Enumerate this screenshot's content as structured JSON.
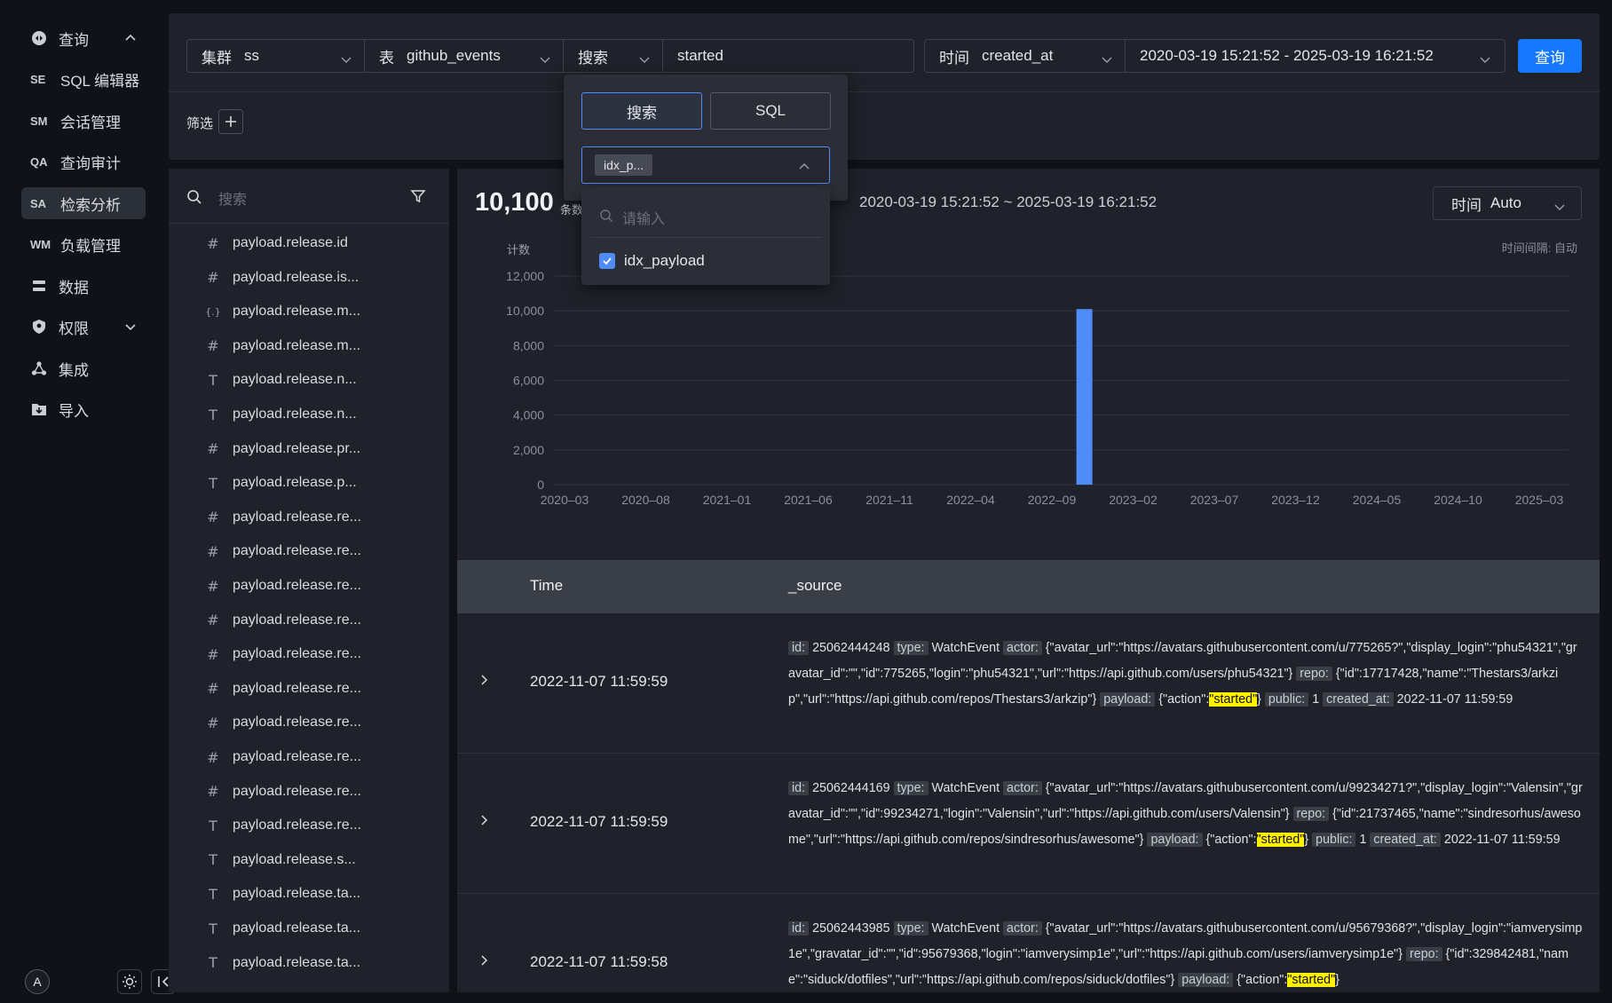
{
  "nav": {
    "query": "查询",
    "items": [
      {
        "abbr": "SE",
        "label": "SQL 编辑器"
      },
      {
        "abbr": "SM",
        "label": "会话管理"
      },
      {
        "abbr": "QA",
        "label": "查询审计"
      },
      {
        "abbr": "SA",
        "label": "检索分析"
      },
      {
        "abbr": "WM",
        "label": "负载管理"
      }
    ],
    "data": "数据",
    "permission": "权限",
    "integration": "集成",
    "import": "导入",
    "avatar": "A"
  },
  "querybar": {
    "cluster_label": "集群",
    "cluster_value": "ss",
    "table_label": "表",
    "table_value": "github_events",
    "mode_label": "搜索",
    "search_text": "started",
    "time_label": "时间",
    "time_field": "created_at",
    "time_range": "2020-03-19 15:21:52 - 2025-03-19 16:21:52",
    "query_button": "查询"
  },
  "filter": {
    "label": "筛选"
  },
  "popover": {
    "search_tab": "搜索",
    "sql_tab": "SQL",
    "selected_tag": "idx_p...",
    "input_placeholder": "请输入",
    "option": "idx_payload"
  },
  "fieldlist": {
    "search_placeholder": "搜索",
    "fields": [
      {
        "type": "#",
        "name": "payload.release.id"
      },
      {
        "type": "#",
        "name": "payload.release.is..."
      },
      {
        "type": "{.}",
        "name": "payload.release.m..."
      },
      {
        "type": "#",
        "name": "payload.release.m..."
      },
      {
        "type": "T",
        "name": "payload.release.n..."
      },
      {
        "type": "T",
        "name": "payload.release.n..."
      },
      {
        "type": "#",
        "name": "payload.release.pr..."
      },
      {
        "type": "T",
        "name": "payload.release.p..."
      },
      {
        "type": "#",
        "name": "payload.release.re..."
      },
      {
        "type": "#",
        "name": "payload.release.re..."
      },
      {
        "type": "#",
        "name": "payload.release.re..."
      },
      {
        "type": "#",
        "name": "payload.release.re..."
      },
      {
        "type": "#",
        "name": "payload.release.re..."
      },
      {
        "type": "#",
        "name": "payload.release.re..."
      },
      {
        "type": "#",
        "name": "payload.release.re..."
      },
      {
        "type": "#",
        "name": "payload.release.re..."
      },
      {
        "type": "#",
        "name": "payload.release.re..."
      },
      {
        "type": "T",
        "name": "payload.release.re..."
      },
      {
        "type": "T",
        "name": "payload.release.s..."
      },
      {
        "type": "T",
        "name": "payload.release.ta..."
      },
      {
        "type": "T",
        "name": "payload.release.ta..."
      },
      {
        "type": "T",
        "name": "payload.release.ta..."
      }
    ]
  },
  "results": {
    "count": "10,100",
    "count_unit": "条数",
    "range": "2020-03-19 15:21:52 ~ 2025-03-19 16:21:52",
    "interval_label": "时间",
    "interval_value": "Auto"
  },
  "chart_data": {
    "type": "bar",
    "ylabel": "计数",
    "note": "时间间隔: 自动",
    "ylim": [
      0,
      12000
    ],
    "yticks": [
      0,
      2000,
      4000,
      6000,
      8000,
      10000,
      12000
    ],
    "ytick_labels": [
      "0",
      "2,000",
      "4,000",
      "6,000",
      "8,000",
      "10,000",
      "12,000"
    ],
    "xticks": [
      "2020–03",
      "2020–08",
      "2021–01",
      "2021–06",
      "2021–11",
      "2022–04",
      "2022–09",
      "2023–02",
      "2023–07",
      "2023–12",
      "2024–05",
      "2024–10",
      "2025–03"
    ],
    "bars": [
      {
        "x": "2022-11",
        "value": 10100
      }
    ],
    "color": "#4f8cf7"
  },
  "table": {
    "col_time": "Time",
    "col_source": "_source",
    "rows": [
      {
        "time": "2022-11-07 11:59:59",
        "source": [
          {
            "k": "id:"
          },
          {
            "t": " 25062444248 "
          },
          {
            "k": "type:"
          },
          {
            "t": " WatchEvent "
          },
          {
            "k": "actor:"
          },
          {
            "t": " {\"avatar_url\":\"https://avatars.githubusercontent.com/u/775265?\",\"display_login\":\"phu54321\",\"gravatar_id\":\"\",\"id\":775265,\"login\":\"phu54321\",\"url\":\"https://api.github.com/users/phu54321\"} "
          },
          {
            "k": "repo:"
          },
          {
            "t": " {\"id\":17717428,\"name\":\"Thestars3/arkzip\",\"url\":\"https://api.github.com/repos/Thestars3/arkzip\"} "
          },
          {
            "k": "payload:"
          },
          {
            "t": " {\"action\":"
          },
          {
            "h": "\"started\""
          },
          {
            "t": "} "
          },
          {
            "k": "public:"
          },
          {
            "t": " 1 "
          },
          {
            "k": "created_at:"
          },
          {
            "t": " 2022-11-07 11:59:59"
          }
        ]
      },
      {
        "time": "2022-11-07 11:59:59",
        "source": [
          {
            "k": "id:"
          },
          {
            "t": " 25062444169 "
          },
          {
            "k": "type:"
          },
          {
            "t": " WatchEvent "
          },
          {
            "k": "actor:"
          },
          {
            "t": " {\"avatar_url\":\"https://avatars.githubusercontent.com/u/99234271?\",\"display_login\":\"Valensin\",\"gravatar_id\":\"\",\"id\":99234271,\"login\":\"Valensin\",\"url\":\"https://api.github.com/users/Valensin\"} "
          },
          {
            "k": "repo:"
          },
          {
            "t": " {\"id\":21737465,\"name\":\"sindresorhus/awesome\",\"url\":\"https://api.github.com/repos/sindresorhus/awesome\"} "
          },
          {
            "k": "payload:"
          },
          {
            "t": " {\"action\":"
          },
          {
            "h": "\"started\""
          },
          {
            "t": "} "
          },
          {
            "k": "public:"
          },
          {
            "t": " 1 "
          },
          {
            "k": "created_at:"
          },
          {
            "t": " 2022-11-07 11:59:59"
          }
        ]
      },
      {
        "time": "2022-11-07 11:59:58",
        "source": [
          {
            "k": "id:"
          },
          {
            "t": " 25062443985 "
          },
          {
            "k": "type:"
          },
          {
            "t": " WatchEvent "
          },
          {
            "k": "actor:"
          },
          {
            "t": " {\"avatar_url\":\"https://avatars.githubusercontent.com/u/95679368?\",\"display_login\":\"iamverysimp1e\",\"gravatar_id\":\"\",\"id\":95679368,\"login\":\"iamverysimp1e\",\"url\":\"https://api.github.com/users/iamverysimp1e\"} "
          },
          {
            "k": "repo:"
          },
          {
            "t": " {\"id\":329842481,\"name\":\"siduck/dotfiles\",\"url\":\"https://api.github.com/repos/siduck/dotfiles\"} "
          },
          {
            "k": "payload:"
          },
          {
            "t": " {\"action\":"
          },
          {
            "h": "\"started\""
          },
          {
            "t": "}"
          }
        ]
      }
    ]
  }
}
